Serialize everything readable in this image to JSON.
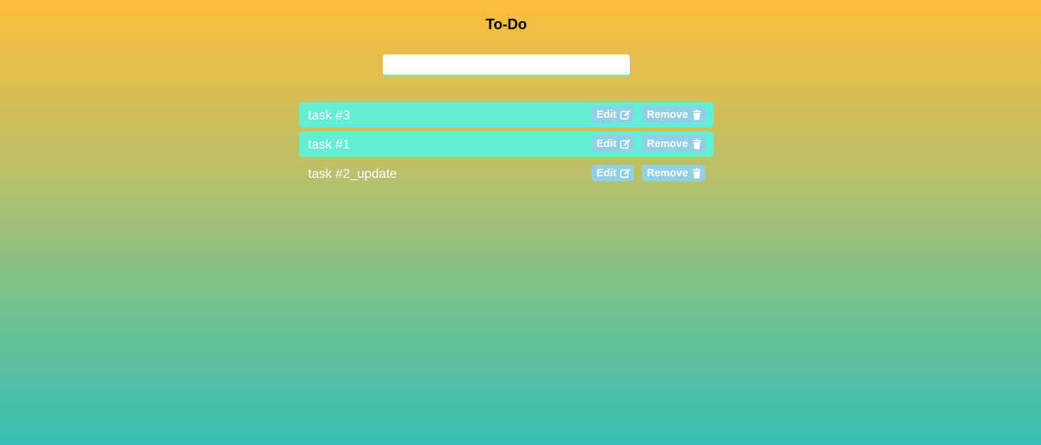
{
  "header": {
    "title": "To-Do"
  },
  "input": {
    "value": "",
    "placeholder": ""
  },
  "tasks": [
    {
      "label": "task #3",
      "highlighted": true,
      "edit_label": "Edit",
      "remove_label": "Remove"
    },
    {
      "label": "task #1",
      "highlighted": true,
      "edit_label": "Edit",
      "remove_label": "Remove"
    },
    {
      "label": "task #2_update",
      "highlighted": false,
      "edit_label": "Edit",
      "remove_label": "Remove"
    }
  ],
  "icons": {
    "edit": "edit-icon",
    "remove": "trash-icon"
  },
  "colors": {
    "gradient_top": "#fdbe3a",
    "gradient_bottom": "#36bfb4",
    "row_highlight": "#64efd4",
    "button_bg": "#8fd0e8",
    "text": "#ffffff",
    "title": "#000000"
  }
}
